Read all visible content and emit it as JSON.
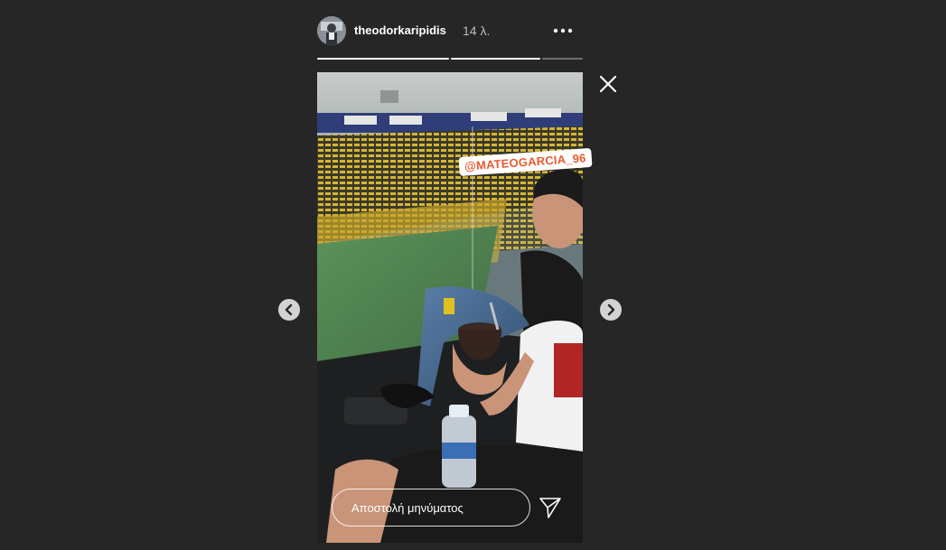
{
  "story": {
    "username": "theodorkaripidis",
    "timestamp": "14 λ.",
    "progress": [
      1.0,
      1.0,
      0.0
    ],
    "mention": "@MATEOGARCIA_96",
    "reply_placeholder": "Αποστολή μηνύματος"
  },
  "icons": {
    "more": "more-options-icon",
    "close": "close-icon",
    "prev": "chevron-left-icon",
    "next": "chevron-right-icon",
    "send": "paper-plane-icon"
  },
  "colors": {
    "background": "#262626",
    "mention_text": "#e8592d",
    "stand_yellow": "#d8b530",
    "pitch_green": "#3f7a3a"
  }
}
